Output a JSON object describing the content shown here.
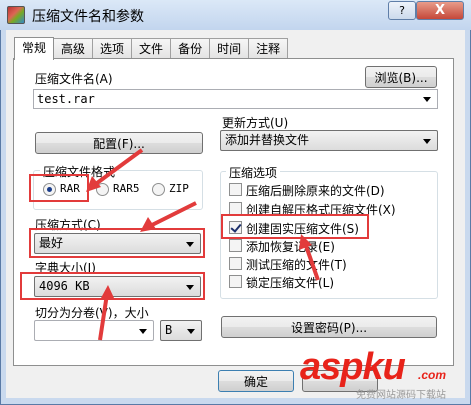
{
  "window": {
    "title": "压缩文件名和参数",
    "help": "?",
    "close": "X"
  },
  "tabs": [
    "常规",
    "高级",
    "选项",
    "文件",
    "备份",
    "时间",
    "注释"
  ],
  "archive_name": {
    "label": "压缩文件名(A)",
    "value": "test.rar",
    "browse": "浏览(B)..."
  },
  "update_mode": {
    "label": "更新方式(U)",
    "value": "添加并替换文件"
  },
  "profiles_button": "配置(F)...",
  "format": {
    "label": "压缩文件格式",
    "options": [
      "RAR",
      "RAR5",
      "ZIP"
    ],
    "selected": "RAR"
  },
  "method": {
    "label": "压缩方式(C)",
    "value": "最好"
  },
  "dictionary": {
    "label": "字典大小(I)",
    "value": "4096 KB"
  },
  "split": {
    "label": "切分为分卷(V)，大小",
    "unit": "B"
  },
  "archive_options": {
    "label": "压缩选项",
    "items": [
      {
        "label": "压缩后删除原来的文件(D)",
        "checked": false
      },
      {
        "label": "创建自解压格式压缩文件(X)",
        "checked": false
      },
      {
        "label": "创建固实压缩文件(S)",
        "checked": true
      },
      {
        "label": "添加恢复记录(E)",
        "checked": false
      },
      {
        "label": "测试压缩的文件(T)",
        "checked": false
      },
      {
        "label": "锁定压缩文件(L)",
        "checked": false
      }
    ]
  },
  "password_button": "设置密码(P)...",
  "ok_button": "确定",
  "watermark": {
    "brand": "aspku",
    "tld": ".com",
    "sub": "免费网站源码下载站"
  },
  "colors": {
    "annotation": "#e23b3b",
    "watermark": "#e8231a"
  }
}
